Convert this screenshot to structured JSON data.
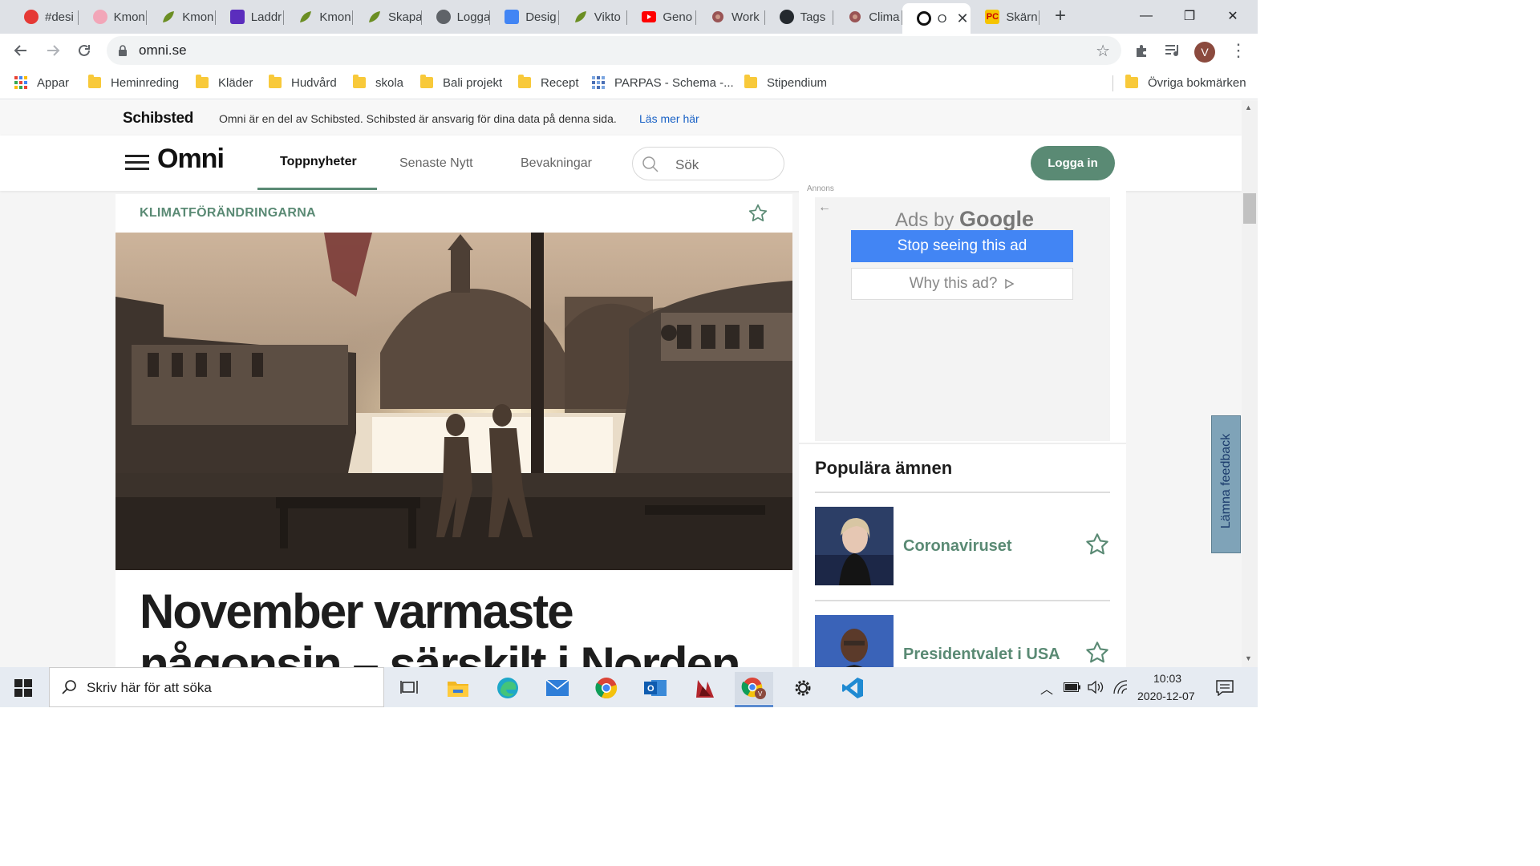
{
  "browser": {
    "tabs": [
      {
        "label": "#desi",
        "icon": "red-dot-icon",
        "color": "#e53935"
      },
      {
        "label": "Kmon",
        "icon": "pink-circle-icon",
        "color": "#f2a6b8"
      },
      {
        "label": "Kmon",
        "icon": "leaf-icon",
        "color": "#6b8e23"
      },
      {
        "label": "Laddr",
        "icon": "purple-square-icon",
        "color": "#5b2dbd"
      },
      {
        "label": "Kmon",
        "icon": "leaf-icon",
        "color": "#6b8e23"
      },
      {
        "label": "Skapa",
        "icon": "leaf-icon",
        "color": "#6b8e23"
      },
      {
        "label": "Logga",
        "icon": "globe-icon",
        "color": "#5f6368"
      },
      {
        "label": "Desig",
        "icon": "docs-icon",
        "color": "#4285f4"
      },
      {
        "label": "Vikto",
        "icon": "leaf-icon",
        "color": "#6b8e23"
      },
      {
        "label": "Geno",
        "icon": "youtube-icon",
        "color": "#ff0000"
      },
      {
        "label": "Work",
        "icon": "flower-icon",
        "color": "#8d3b3b"
      },
      {
        "label": "Tags",
        "icon": "github-icon",
        "color": "#24292e"
      },
      {
        "label": "Clima",
        "icon": "flower-icon",
        "color": "#8d3b3b"
      },
      {
        "label": "O",
        "icon": "omni-icon",
        "color": "#111111",
        "active": true
      },
      {
        "label": "Skärn",
        "icon": "pc-icon",
        "color": "#f5c400"
      }
    ],
    "url": "omni.se",
    "profile_initial": "V",
    "bookmarks": [
      {
        "label": "Appar",
        "type": "apps"
      },
      {
        "label": "Heminreding",
        "type": "folder"
      },
      {
        "label": "Kläder",
        "type": "folder"
      },
      {
        "label": "Hudvård",
        "type": "folder"
      },
      {
        "label": "skola",
        "type": "folder"
      },
      {
        "label": "Bali projekt",
        "type": "folder"
      },
      {
        "label": "Recept",
        "type": "folder"
      },
      {
        "label": "PARPAS - Schema -...",
        "type": "site"
      },
      {
        "label": "Stipendium",
        "type": "folder"
      }
    ],
    "other_bookmarks": "Övriga bokmärken"
  },
  "notice": {
    "brand": "Schibsted",
    "text": "Omni är en del av Schibsted. Schibsted är ansvarig för dina data på denna sida.",
    "link": "Läs mer här"
  },
  "header": {
    "logo": "Omni",
    "nav": [
      "Toppnyheter",
      "Senaste Nytt",
      "Bevakningar"
    ],
    "active_nav": "Toppnyheter",
    "search_placeholder": "Sök",
    "login": "Logga in",
    "accent_color": "#5a8a74"
  },
  "article": {
    "topic": "KLIMATFÖRÄNDRINGARNA",
    "headline": "November varmaste någonsin – särskilt i Norden"
  },
  "ad": {
    "annons": "Annons",
    "ads_by": "Ads by",
    "google": "Google",
    "stop": "Stop seeing this ad",
    "why": "Why this ad?"
  },
  "popular": {
    "title": "Populära ämnen",
    "items": [
      {
        "label": "Coronaviruset"
      },
      {
        "label": "Presidentvalet i USA"
      }
    ]
  },
  "feedback": "Lämna feedback",
  "taskbar": {
    "search_placeholder": "Skriv här för att söka",
    "time": "10:03",
    "date": "2020-12-07"
  }
}
